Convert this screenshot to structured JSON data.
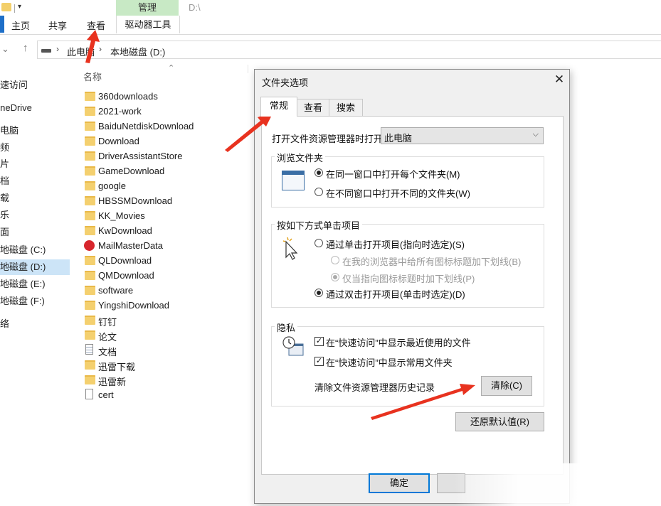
{
  "ribbon": {
    "context_group": "管理",
    "path_hint": "D:\\",
    "tabs": [
      "主页",
      "共享",
      "查看"
    ],
    "context_tab": "驱动器工具"
  },
  "address": {
    "crumbs": [
      "此电脑",
      "本地磁盘 (D:)"
    ]
  },
  "nav": {
    "items": [
      {
        "label": "快速访问",
        "selected": false
      },
      {
        "label": "OneDrive",
        "selected": false
      },
      {
        "label": "此电脑",
        "selected": false
      },
      {
        "label": "视频",
        "selected": false
      },
      {
        "label": "图片",
        "selected": false
      },
      {
        "label": "文档",
        "selected": false
      },
      {
        "label": "下载",
        "selected": false
      },
      {
        "label": "音乐",
        "selected": false
      },
      {
        "label": "桌面",
        "selected": false
      },
      {
        "label": "本地磁盘 (C:)",
        "selected": false
      },
      {
        "label": "本地磁盘 (D:)",
        "selected": true
      },
      {
        "label": "本地磁盘 (E:)",
        "selected": false
      },
      {
        "label": "本地磁盘 (F:)",
        "selected": false
      },
      {
        "label": "网络",
        "selected": false
      }
    ]
  },
  "files": {
    "column_name": "名称",
    "rows": [
      {
        "name": "360downloads",
        "icon": "folder-icon"
      },
      {
        "name": "2021-work",
        "icon": "folder-icon"
      },
      {
        "name": "BaiduNetdiskDownload",
        "icon": "folder-icon"
      },
      {
        "name": "Download",
        "icon": "folder-icon"
      },
      {
        "name": "DriverAssistantStore",
        "icon": "folder-icon"
      },
      {
        "name": "GameDownload",
        "icon": "folder-icon"
      },
      {
        "name": "google",
        "icon": "folder-icon"
      },
      {
        "name": "HBSSMDownload",
        "icon": "folder-icon"
      },
      {
        "name": "KK_Movies",
        "icon": "folder-icon"
      },
      {
        "name": "KwDownload",
        "icon": "folder-icon"
      },
      {
        "name": "MailMasterData",
        "icon": "mailmaster-icon"
      },
      {
        "name": "QLDownload",
        "icon": "folder-icon"
      },
      {
        "name": "QMDownload",
        "icon": "folder-icon"
      },
      {
        "name": "software",
        "icon": "folder-icon"
      },
      {
        "name": "YingshiDownload",
        "icon": "folder-icon"
      },
      {
        "name": "钉钉",
        "icon": "folder-icon"
      },
      {
        "name": "论文",
        "icon": "folder-icon"
      },
      {
        "name": "文档",
        "icon": "text-document-icon"
      },
      {
        "name": "迅雷下载",
        "icon": "folder-icon"
      },
      {
        "name": "迅雷新",
        "icon": "folder-icon"
      },
      {
        "name": "cert",
        "icon": "blank-file-icon"
      }
    ]
  },
  "dialog": {
    "title": "文件夹选项",
    "tabs": [
      "常规",
      "查看",
      "搜索"
    ],
    "open_label": "打开文件资源管理器时打开:",
    "open_value": "此电脑",
    "browse_group": "浏览文件夹",
    "browse_same": "在同一窗口中打开每个文件夹(M)",
    "browse_new": "在不同窗口中打开不同的文件夹(W)",
    "click_group": "按如下方式单击项目",
    "single_click": "通过单击打开项目(指向时选定)(S)",
    "underline_all": "在我的浏览器中给所有图标标题加下划线(B)",
    "underline_hover": "仅当指向图标标题时加下划线(P)",
    "double_click": "通过双击打开项目(单击时选定)(D)",
    "privacy_group": "隐私",
    "recent_files": "在“快速访问”中显示最近使用的文件",
    "frequent_folders": "在“快速访问”中显示常用文件夹",
    "clear_history_label": "清除文件资源管理器历史记录",
    "clear_button": "清除(C)",
    "restore_button": "还原默认值(R)",
    "ok_button": "确定",
    "close_glyph": "✕"
  },
  "colors": {
    "annotation_arrow": "#e8321f",
    "context_tab": "#c8e9c5",
    "selected_nav": "#cce4f7",
    "default_button_border": "#0078d7"
  }
}
